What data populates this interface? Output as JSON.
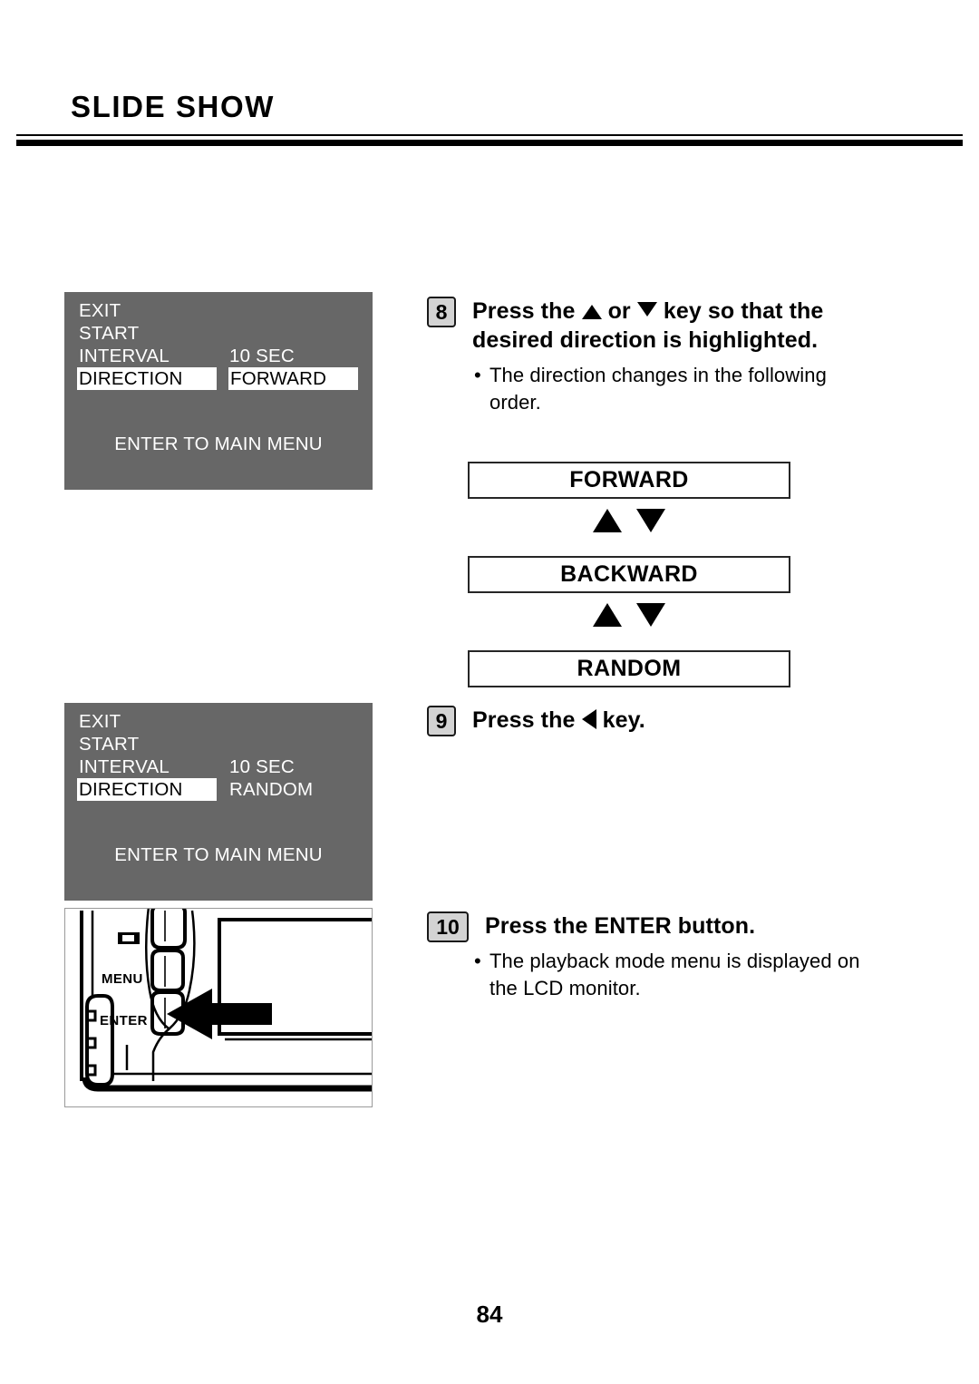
{
  "document": {
    "title": "SLIDE SHOW",
    "page_number": "84"
  },
  "lcd_screens": [
    {
      "name": "slide-show-menu-forward",
      "rows": [
        {
          "label": "EXIT",
          "value": "",
          "label_highlighted": false,
          "value_highlighted": false
        },
        {
          "label": "START",
          "value": "",
          "label_highlighted": false,
          "value_highlighted": false
        },
        {
          "label": "INTERVAL",
          "value": "10 SEC",
          "label_highlighted": false,
          "value_highlighted": false
        },
        {
          "label": "DIRECTION",
          "value": "FORWARD",
          "label_highlighted": true,
          "value_highlighted": true
        }
      ],
      "footer": "ENTER TO MAIN MENU",
      "background_color": "#676767",
      "text_color": "#ffffff",
      "highlight_bg": "#ffffff",
      "highlight_fg": "#000000"
    },
    {
      "name": "slide-show-menu-random",
      "rows": [
        {
          "label": "EXIT",
          "value": "",
          "label_highlighted": false,
          "value_highlighted": false
        },
        {
          "label": "START",
          "value": "",
          "label_highlighted": false,
          "value_highlighted": false
        },
        {
          "label": "INTERVAL",
          "value": "10 SEC",
          "label_highlighted": false,
          "value_highlighted": false
        },
        {
          "label": "DIRECTION",
          "value": "RANDOM",
          "label_highlighted": true,
          "value_highlighted": false
        }
      ],
      "footer": "ENTER TO MAIN MENU",
      "background_color": "#676767",
      "text_color": "#ffffff",
      "highlight_bg": "#ffffff",
      "highlight_fg": "#000000"
    }
  ],
  "steps": [
    {
      "number": "8",
      "heading_line1": "Press the ▲ or ▼ key so that the",
      "heading_line2": "desired direction is highlighted.",
      "heading_pre": "Press the",
      "heading_mid": "or",
      "heading_post": "key so that the",
      "heading_second": "desired direction is highlighted.",
      "bullet_line1": "The direction changes in the following",
      "bullet_line2": "order.",
      "bullet_char": "•"
    },
    {
      "number": "9",
      "heading_pre": "Press the",
      "heading_post": "key."
    },
    {
      "number": "10",
      "heading": "Press the ENTER button.",
      "bullet_line1": "The playback mode menu is displayed on",
      "bullet_line2": "the LCD monitor.",
      "bullet_char": "•"
    }
  ],
  "flow_diagram": {
    "boxes": [
      "FORWARD",
      "BACKWARD",
      "RANDOM"
    ],
    "connector_icons": [
      "up-triangle",
      "down-triangle"
    ]
  },
  "camera_illustration": {
    "labels": {
      "menu_button": "MENU",
      "enter_button": "ENTER"
    },
    "display_icon": "camera-display-icon",
    "pointer": "left-arrow-pointing-at-enter-button"
  }
}
